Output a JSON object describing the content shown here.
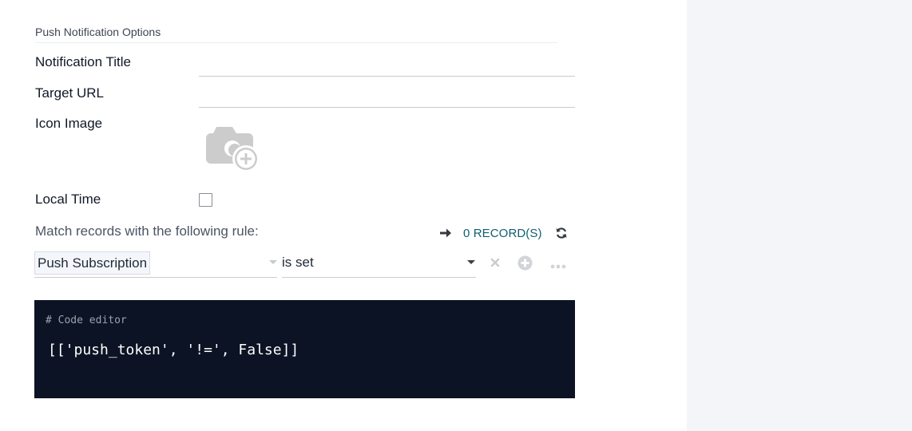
{
  "section": {
    "title": "Push Notification Options"
  },
  "fields": {
    "notification_title": {
      "label": "Notification Title",
      "value": ""
    },
    "target_url": {
      "label": "Target URL",
      "value": ""
    },
    "icon_image": {
      "label": "Icon Image",
      "icon": "camera-add-icon"
    },
    "local_time": {
      "label": "Local Time",
      "checked": false
    }
  },
  "domain_rule": {
    "intro": "Match records with the following rule:",
    "record_count": "0 RECORD(S)",
    "field_path": "Push Subscription",
    "operator": "is set",
    "icons": [
      "arrow-right-icon",
      "refresh-icon",
      "delete-icon",
      "add-icon",
      "more-icon"
    ]
  },
  "code_editor": {
    "comment": "# Code editor",
    "code": "[['push_token', '!=', False]]"
  },
  "colors": {
    "record_count": "#0f5f70",
    "code_background": "#0b1324",
    "side_panel": "#f4f5f9"
  }
}
